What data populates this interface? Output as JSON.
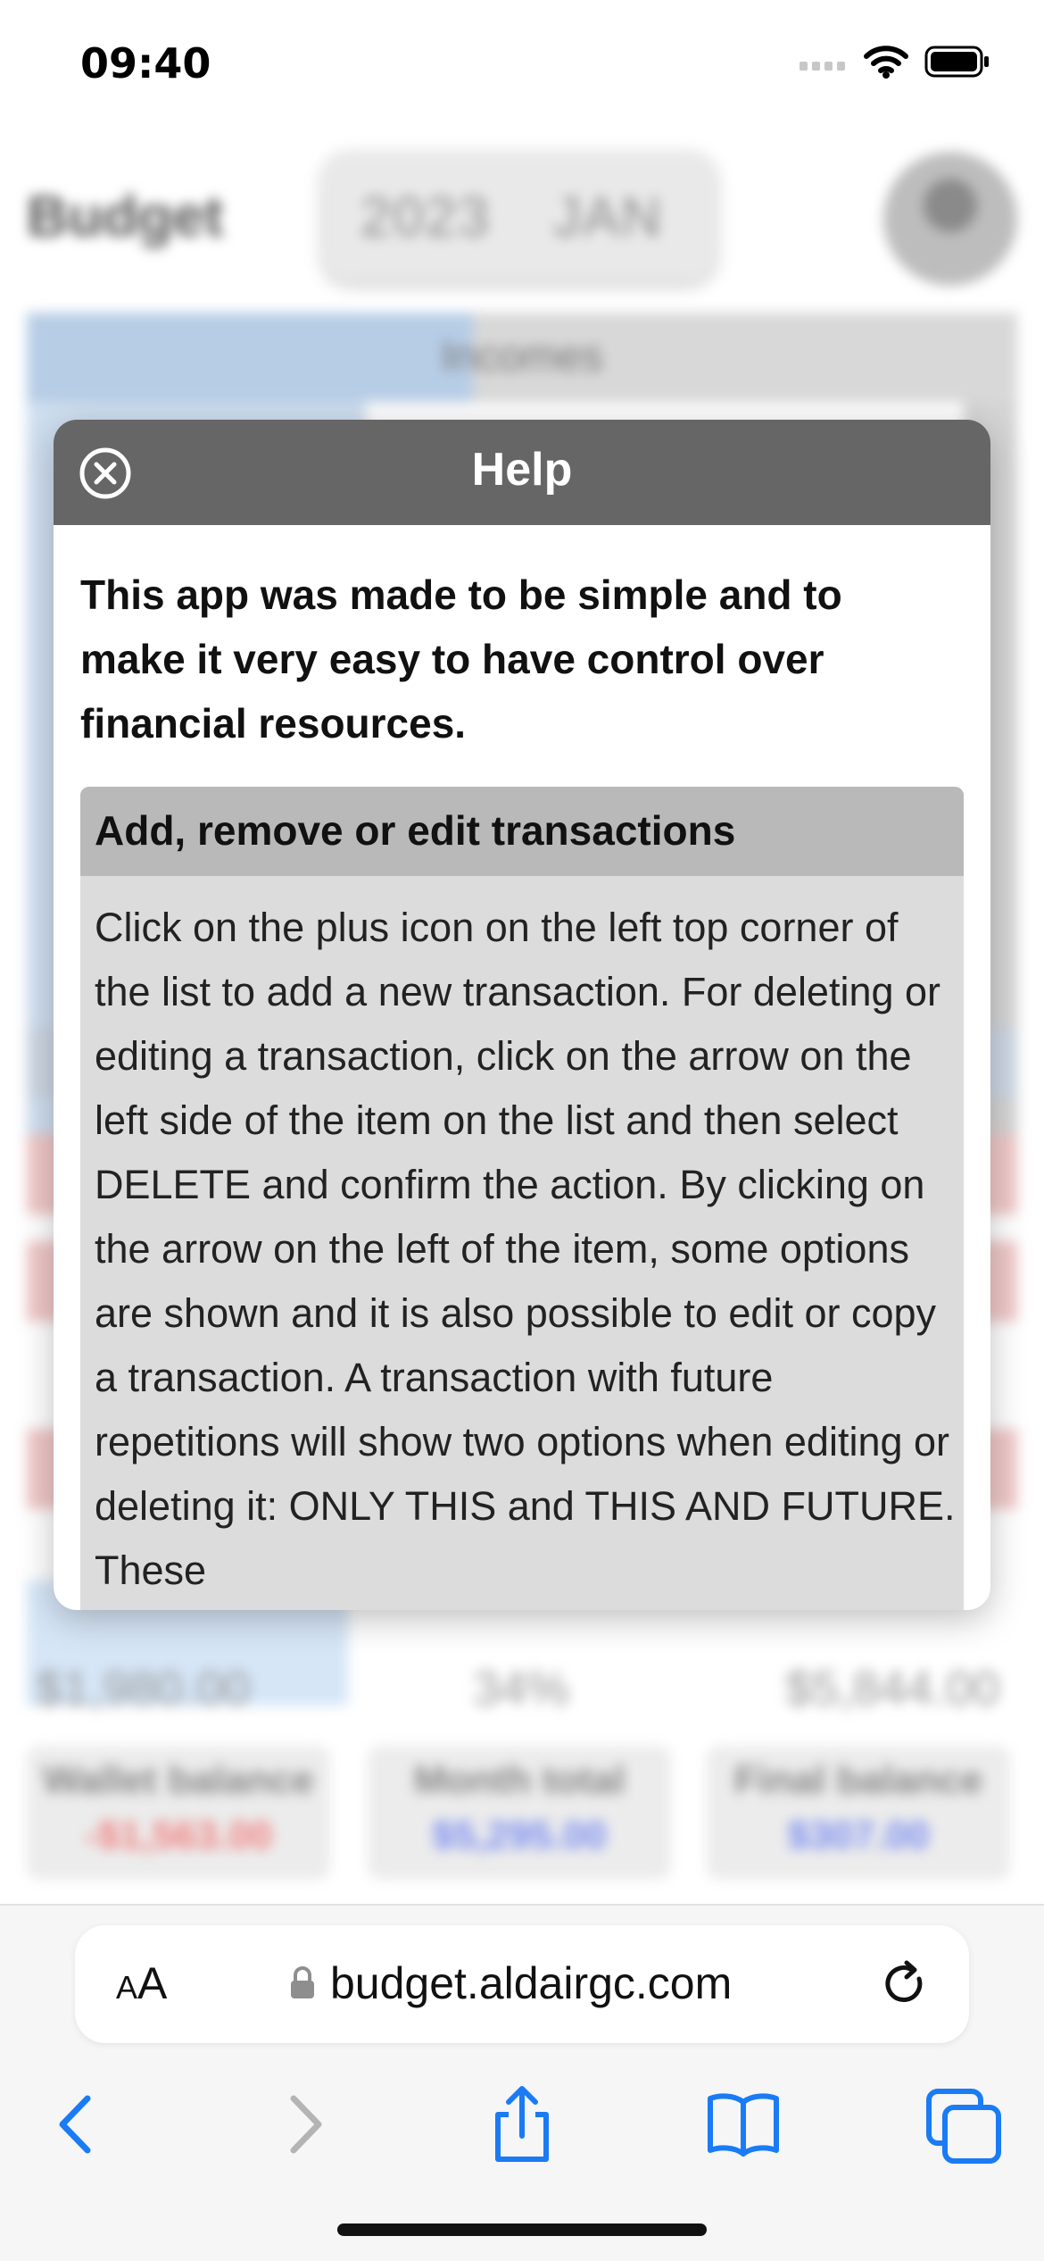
{
  "status_bar": {
    "time": "09:40"
  },
  "background_app": {
    "title": "Budget",
    "picker": {
      "year": "2023",
      "month": "JAN"
    },
    "incomes_label": "Incomes",
    "footer_numbers": [
      "$1,980.00",
      "34%",
      "$5,844.00"
    ],
    "cards": [
      {
        "label": "Wallet balance",
        "value": "-$1,563.00",
        "color": "#f08080"
      },
      {
        "label": "Month total",
        "value": "$5,295.00",
        "color": "#7a8cf0"
      },
      {
        "label": "Final balance",
        "value": "$307.00",
        "color": "#7a8cf0"
      }
    ]
  },
  "help_modal": {
    "title": "Help",
    "intro": "This app was made to be simple and to make it very easy to have control over financial resources.",
    "section": {
      "title": "Add, remove or edit transactions",
      "body": "Click on the plus icon on the left top corner of the list to add a new transaction. For deleting or editing a transaction, click on the arrow on the left side of the item on the list and then select DELETE and confirm the action. By clicking on the arrow on the left of the item, some options are shown and it is also possible to edit or copy a transaction. A transaction with future repetitions will show two options when editing or deleting it: ONLY THIS and THIS AND FUTURE. These"
    }
  },
  "browser": {
    "aa_label_small": "A",
    "aa_label_large": "A",
    "url": "budget.aldairgc.com",
    "accent_color": "#1a7bf5"
  }
}
